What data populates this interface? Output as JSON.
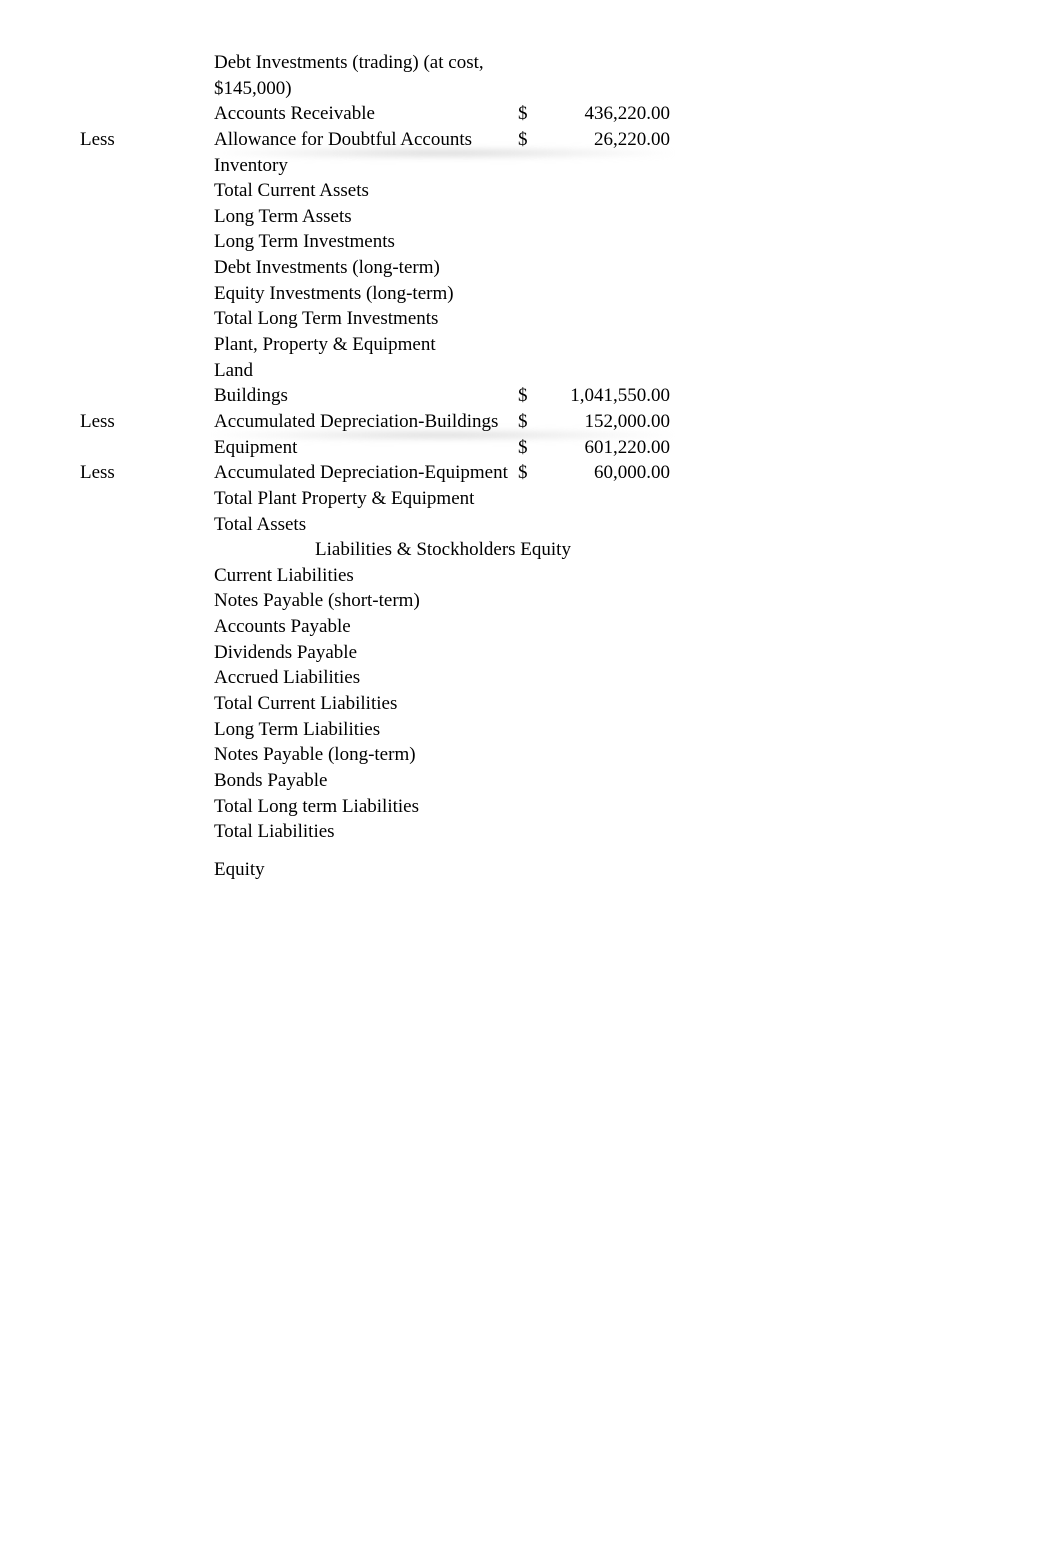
{
  "less_label": "Less",
  "currency_symbol": "$",
  "rows": [
    {
      "tag": "",
      "label": "Debt Investments (trading) (at cost, $145,000)",
      "sym": "",
      "val": ""
    },
    {
      "tag": "",
      "label": "Accounts Receivable",
      "sym": "$",
      "val": "436,220.00"
    },
    {
      "tag": "Less",
      "label": "Allowance for Doubtful Accounts",
      "sym": "$",
      "val": "26,220.00",
      "blur": true
    },
    {
      "tag": "",
      "label": "Inventory",
      "sym": "",
      "val": ""
    },
    {
      "tag": "",
      "label": "Total Current Assets",
      "sym": "",
      "val": ""
    },
    {
      "tag": "",
      "label": "Long Term Assets",
      "sym": "",
      "val": ""
    },
    {
      "tag": "",
      "label": "Long Term Investments",
      "sym": "",
      "val": ""
    },
    {
      "tag": "",
      "label": "Debt Investments (long-term)",
      "sym": "",
      "val": ""
    },
    {
      "tag": "",
      "label": "Equity Investments (long-term)",
      "sym": "",
      "val": ""
    },
    {
      "tag": "",
      "label": "Total Long Term Investments",
      "sym": "",
      "val": ""
    },
    {
      "tag": "",
      "label": "Plant, Property & Equipment",
      "sym": "",
      "val": ""
    },
    {
      "tag": "",
      "label": "Land",
      "sym": "",
      "val": ""
    },
    {
      "tag": "",
      "label": "Buildings",
      "sym": "$",
      "val": "1,041,550.00"
    },
    {
      "tag": "Less",
      "label": "Accumulated Depreciation-Buildings",
      "sym": "$",
      "val": "152,000.00",
      "blur2": true
    },
    {
      "tag": "",
      "label": "Equipment",
      "sym": "$",
      "val": "601,220.00"
    },
    {
      "tag": "Less",
      "label": "Accumulated Depreciation-Equipment",
      "sym": "$",
      "val": "60,000.00"
    },
    {
      "tag": "",
      "label": "Total Plant Property & Equipment",
      "sym": "",
      "val": ""
    },
    {
      "tag": "",
      "label": "Total Assets",
      "sym": "",
      "val": ""
    }
  ],
  "section_header": "Liabilities & Stockholders Equity",
  "rows2": [
    {
      "tag": "",
      "label": "Current Liabilities",
      "sym": "",
      "val": ""
    },
    {
      "tag": "",
      "label": "Notes Payable (short-term)",
      "sym": "",
      "val": ""
    },
    {
      "tag": "",
      "label": "Accounts Payable",
      "sym": "",
      "val": ""
    },
    {
      "tag": "",
      "label": "Dividends Payable",
      "sym": "",
      "val": ""
    },
    {
      "tag": "",
      "label": "Accrued Liabilities",
      "sym": "",
      "val": ""
    },
    {
      "tag": "",
      "label": "Total Current Liabilities",
      "sym": "",
      "val": ""
    },
    {
      "tag": "",
      "label": "Long Term Liabilities",
      "sym": "",
      "val": ""
    },
    {
      "tag": "",
      "label": "Notes Payable (long-term)",
      "sym": "",
      "val": ""
    },
    {
      "tag": "",
      "label": "Bonds Payable",
      "sym": "",
      "val": ""
    },
    {
      "tag": "",
      "label": "Total Long term Liabilities",
      "sym": "",
      "val": ""
    },
    {
      "tag": "",
      "label": "Total Liabilities",
      "sym": "",
      "val": ""
    }
  ],
  "equity_label": "Equity"
}
